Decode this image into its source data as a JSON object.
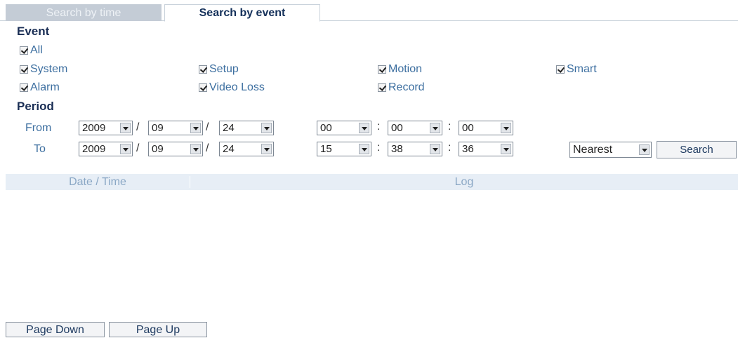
{
  "tabs": [
    {
      "label": "Search by time",
      "active": false
    },
    {
      "label": "Search by event",
      "active": true
    }
  ],
  "event": {
    "title": "Event",
    "all_label": "All",
    "options": [
      {
        "label": "System",
        "checked": true
      },
      {
        "label": "Setup",
        "checked": true
      },
      {
        "label": "Motion",
        "checked": true
      },
      {
        "label": "Smart",
        "checked": true
      },
      {
        "label": "Alarm",
        "checked": true
      },
      {
        "label": "Video Loss",
        "checked": true
      },
      {
        "label": "Record",
        "checked": true
      }
    ]
  },
  "period": {
    "title": "Period",
    "from": {
      "label": "From",
      "year": "2009",
      "month": "09",
      "day": "24",
      "hour": "00",
      "minute": "00",
      "second": "00"
    },
    "to": {
      "label": "To",
      "year": "2009",
      "month": "09",
      "day": "24",
      "hour": "15",
      "minute": "38",
      "second": "36"
    },
    "date_sep": "/",
    "time_sep": ":"
  },
  "search": {
    "mode": "Nearest",
    "button_label": "Search"
  },
  "table": {
    "columns": [
      "Date / Time",
      "Log"
    ],
    "rows": []
  },
  "paging": {
    "page_down_label": "Page Down",
    "page_up_label": "Page Up"
  },
  "colors": {
    "accent_text": "#3d6fa0",
    "title_text": "#1a2e55",
    "header_bg": "#e7eef6"
  }
}
